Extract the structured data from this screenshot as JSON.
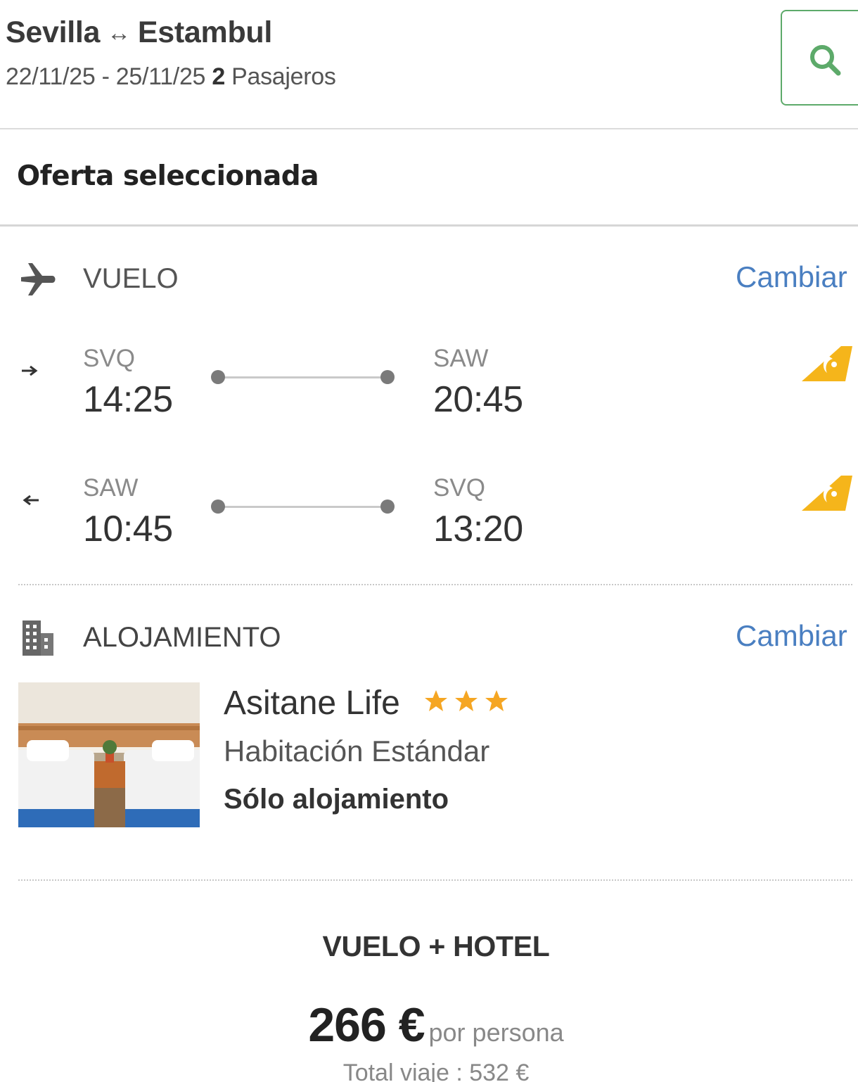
{
  "search": {
    "origin": "Sevilla",
    "route_arrow": "↔",
    "destination": "Estambul",
    "dates": "22/11/25 - 25/11/25",
    "passenger_count": "2",
    "passenger_label": "Pasajeros",
    "button_icon": "search-icon"
  },
  "offer": {
    "title": "Oferta seleccionada"
  },
  "flight": {
    "section_label": "VUELO",
    "change_label": "Cambiar",
    "icon": "airplane-icon",
    "legs": [
      {
        "direction": "outbound",
        "from_code": "SVQ",
        "depart_time": "14:25",
        "to_code": "SAW",
        "arrive_time": "20:45",
        "airline_logo": "airline-logo"
      },
      {
        "direction": "return",
        "from_code": "SAW",
        "depart_time": "10:45",
        "to_code": "SVQ",
        "arrive_time": "13:20",
        "airline_logo": "airline-logo"
      }
    ]
  },
  "hotel": {
    "section_label": "ALOJAMIENTO",
    "change_label": "Cambiar",
    "icon": "building-icon",
    "name": "Asitane Life",
    "stars": 3,
    "room_type": "Habitación Estándar",
    "board": "Sólo alojamiento"
  },
  "price": {
    "package_label": "VUELO + HOTEL",
    "amount": "266 €",
    "unit": "por persona",
    "total": "Total viaje : 532 €"
  },
  "colors": {
    "link": "#4a7fc1",
    "search_border": "#5daa6a",
    "star": "#f5a623",
    "airline": "#f5b51b"
  }
}
